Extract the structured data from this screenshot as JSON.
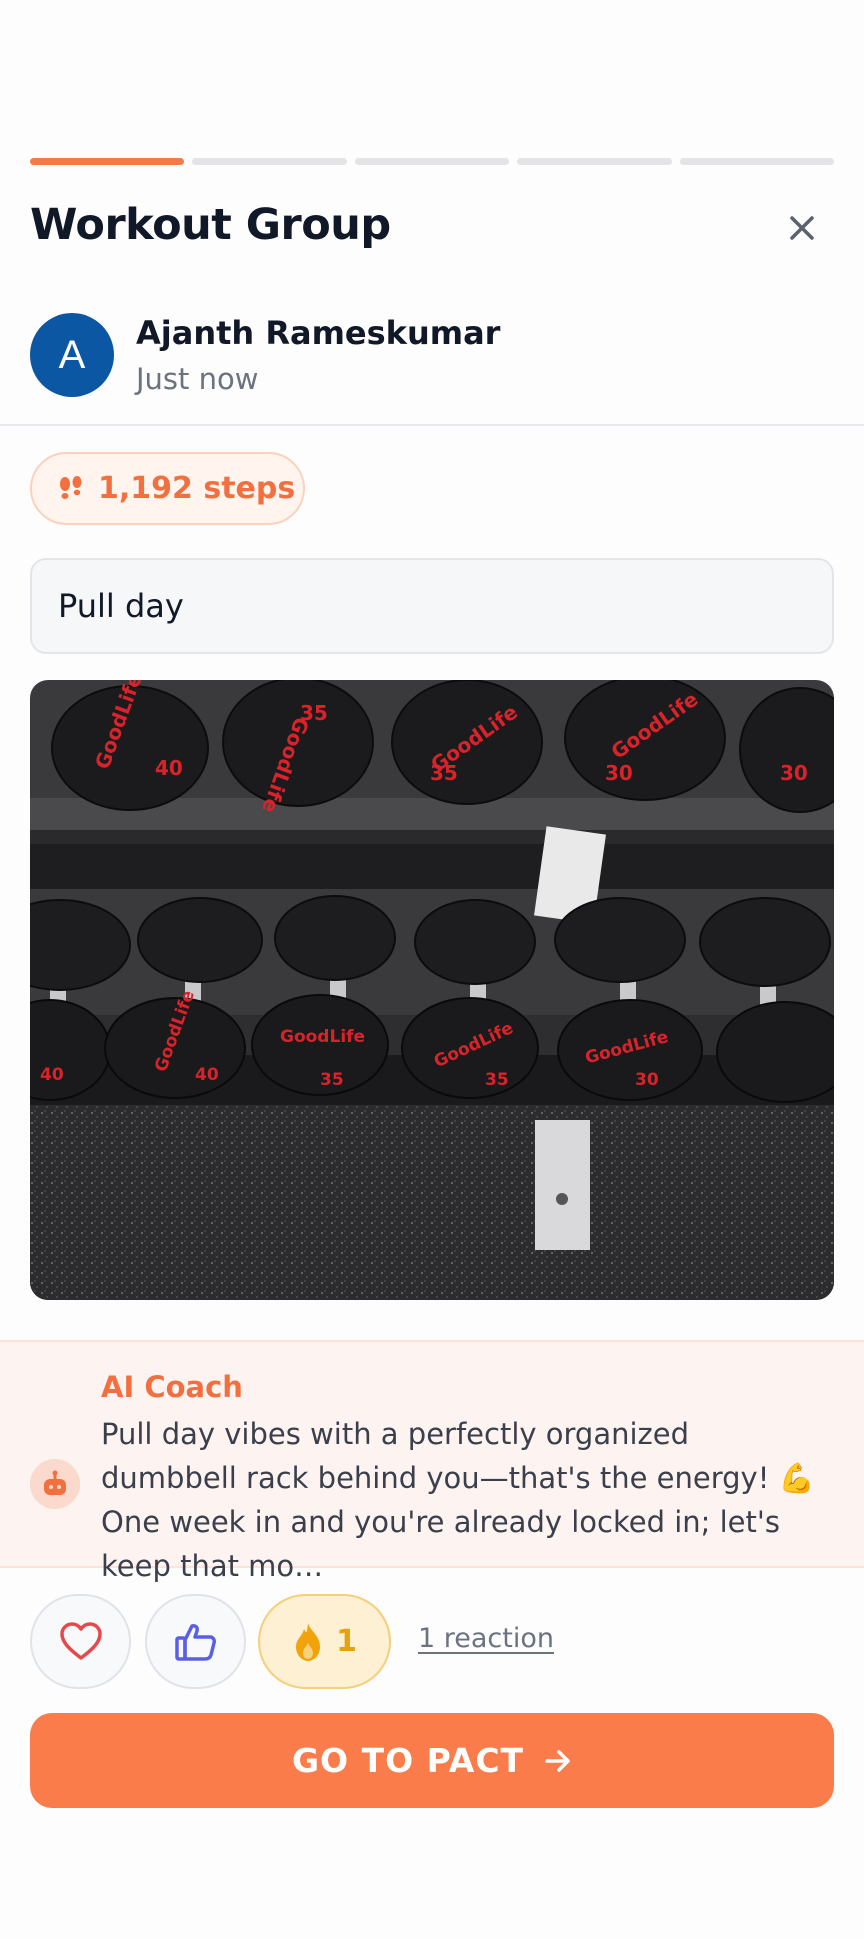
{
  "header": {
    "title": "Workout Group",
    "progress_segments": 5,
    "progress_active_index": 0
  },
  "post": {
    "author_initial": "A",
    "author_name": "Ajanth Rameskumar",
    "timestamp": "Just now",
    "steps_label": "1,192 steps",
    "caption": "Pull day",
    "photo_icon": "dumbbell-rack-photo"
  },
  "coach": {
    "title": "AI Coach",
    "message": "Pull day vibes with a perfectly organized dumbbell rack behind you—that's the energy! 💪 One week in and you're already locked in; let's keep that mo…"
  },
  "reactions": {
    "heart_icon": "heart-icon",
    "thumb_icon": "thumbs-up-icon",
    "fire_icon": "fire-icon",
    "fire_count": "1",
    "summary": "1 reaction"
  },
  "cta": {
    "label": "GO TO PACT"
  },
  "colors": {
    "accent": "#f47a4a",
    "cta": "#fb7c4b",
    "avatar": "#0b57a4",
    "fire": "#e7a10d",
    "thumb": "#5b5fe3",
    "heart": "#e5484d"
  }
}
